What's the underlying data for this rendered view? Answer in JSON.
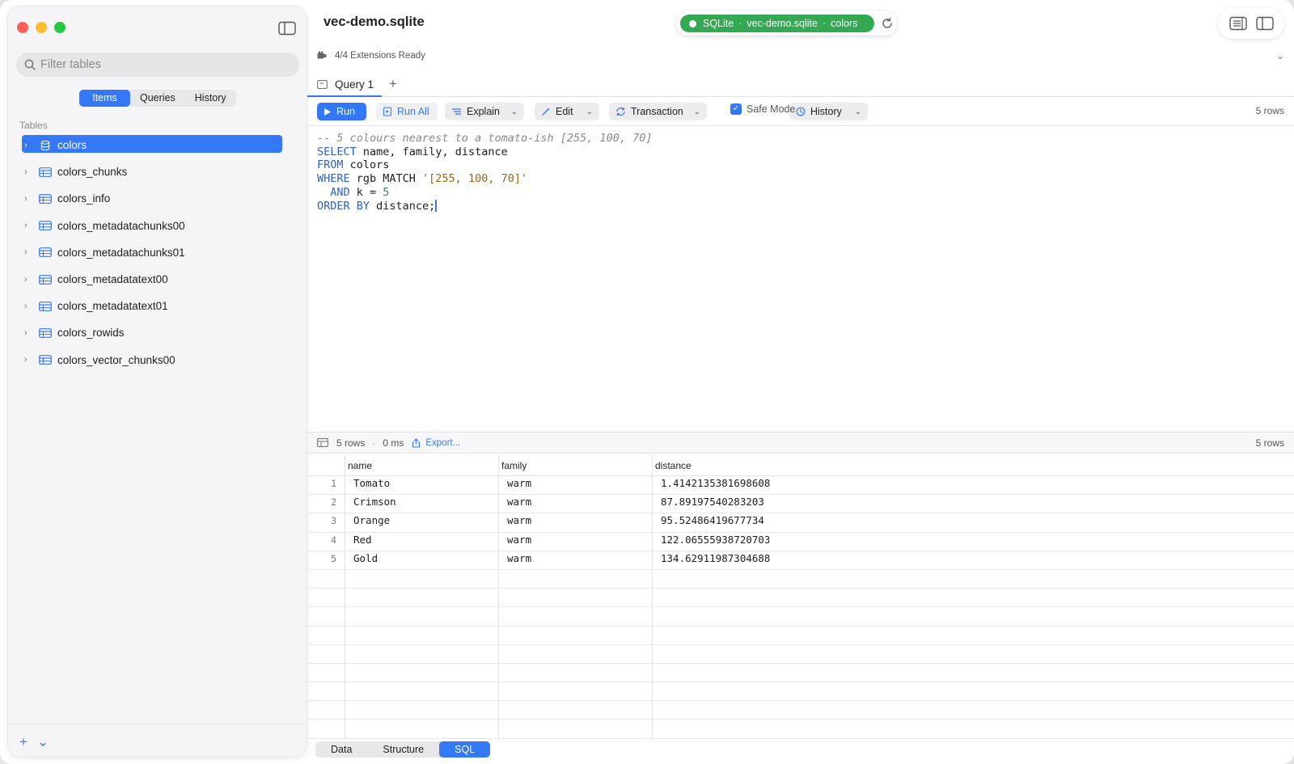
{
  "window": {
    "title": "vec-demo.sqlite"
  },
  "sidebar": {
    "filter_placeholder": "Filter tables",
    "segments": [
      "Items",
      "Queries",
      "History"
    ],
    "section_label": "Tables",
    "tables": [
      "colors",
      "colors_chunks",
      "colors_info",
      "colors_metadatachunks00",
      "colors_metadatachunks01",
      "colors_metadatatext00",
      "colors_metadatatext01",
      "colors_rowids",
      "colors_vector_chunks00"
    ],
    "footer": {
      "add": "+",
      "menu": "⌄"
    }
  },
  "connection": {
    "engine": "SQLite",
    "database": "vec-demo.sqlite",
    "table": "colors",
    "status_color": "#34a853"
  },
  "extensions": {
    "label": "4/4 Extensions Ready"
  },
  "tabs": [
    {
      "label": "Query 1"
    }
  ],
  "toolbar": {
    "run": "Run",
    "run_all": "Run All",
    "explain": "Explain",
    "edit": "Edit",
    "transaction": "Transaction",
    "safe_mode": "Safe Mode",
    "history": "History",
    "row_count": "5 rows"
  },
  "editor": {
    "line1_comment": "-- 5 colours nearest to a tomato-ish [255, 100, 70]",
    "line2_kw": "SELECT",
    "line2_rest": " name, family, distance",
    "line3_kw": "FROM",
    "line3_rest": " colors",
    "line4_kw": "WHERE",
    "line4_mid": " rgb MATCH ",
    "line4_str": "'[255, 100, 70]'",
    "line5_kw": "AND",
    "line5_mid": " k = ",
    "line5_num": "5",
    "line6_kw": "ORDER BY",
    "line6_rest": " distance;"
  },
  "results": {
    "rows_label": "5 rows",
    "time_label": "0 ms",
    "export_label": "Export...",
    "right_count": "5 rows",
    "columns": [
      "name",
      "family",
      "distance"
    ],
    "rows": [
      {
        "idx": "1",
        "name": "Tomato",
        "family": "warm",
        "distance": "1.4142135381698608"
      },
      {
        "idx": "2",
        "name": "Crimson",
        "family": "warm",
        "distance": "87.89197540283203"
      },
      {
        "idx": "3",
        "name": "Orange",
        "family": "warm",
        "distance": "95.52486419677734"
      },
      {
        "idx": "4",
        "name": "Red",
        "family": "warm",
        "distance": "122.06555938720703"
      },
      {
        "idx": "5",
        "name": "Gold",
        "family": "warm",
        "distance": "134.62911987304688"
      }
    ]
  },
  "bottom_tabs": [
    "Data",
    "Structure",
    "SQL"
  ],
  "colors": {
    "accent": "#3478f6",
    "sidebar_bg": "#f5f5f7"
  }
}
